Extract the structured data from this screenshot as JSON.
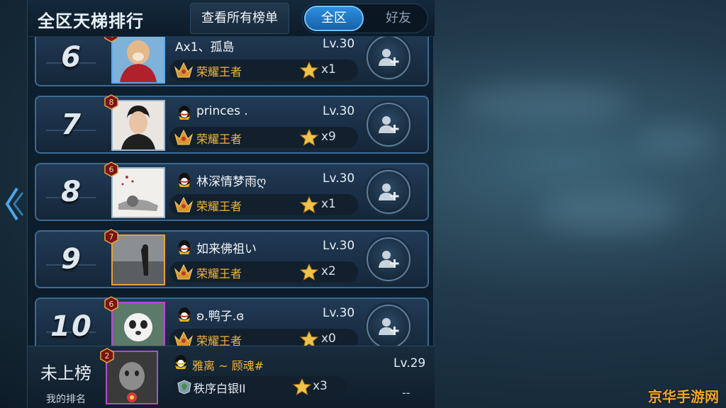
{
  "header": {
    "title": "全区天梯排行",
    "view_all_lists": "查看所有榜单",
    "tabs": [
      {
        "label": "全区",
        "selected": true
      },
      {
        "label": "好友",
        "selected": false
      }
    ]
  },
  "players": [
    {
      "rank": "6",
      "badge_level": "4",
      "name": "Ax1、孤島",
      "level": "Lv.30",
      "rank_tier": "荣耀王者",
      "stars": "x1",
      "has_qq_icon": false,
      "frame": "blue"
    },
    {
      "rank": "7",
      "badge_level": "8",
      "name": "princes .",
      "level": "Lv.30",
      "rank_tier": "荣耀王者",
      "stars": "x9",
      "has_qq_icon": true,
      "frame": "silver"
    },
    {
      "rank": "8",
      "badge_level": "6",
      "name": "林深情梦雨ღ",
      "level": "Lv.30",
      "rank_tier": "荣耀王者",
      "stars": "x1",
      "has_qq_icon": true,
      "frame": "silver"
    },
    {
      "rank": "9",
      "badge_level": "7",
      "name": "如来佛祖い",
      "level": "Lv.30",
      "rank_tier": "荣耀王者",
      "stars": "x2",
      "has_qq_icon": true,
      "frame": "gold"
    },
    {
      "rank": "10",
      "badge_level": "6",
      "name": "ʚ.鸭子.ɞ",
      "level": "Lv.30",
      "rank_tier": "荣耀王者",
      "stars": "x0",
      "has_qq_icon": true,
      "frame": "blue"
    }
  ],
  "my_rank": {
    "status": "未上榜",
    "label": "我的排名",
    "badge_level": "2",
    "name": "雅离 ~ 顾魂#",
    "level": "Lv.29",
    "rank_tier": "秩序白银II",
    "stars": "x3",
    "ranking_value": "--"
  },
  "watermark": "京华手游网",
  "colors": {
    "accent_blue": "#2d8fe0",
    "gold_text": "#f0b43a",
    "row_border": "#3c6a92"
  }
}
